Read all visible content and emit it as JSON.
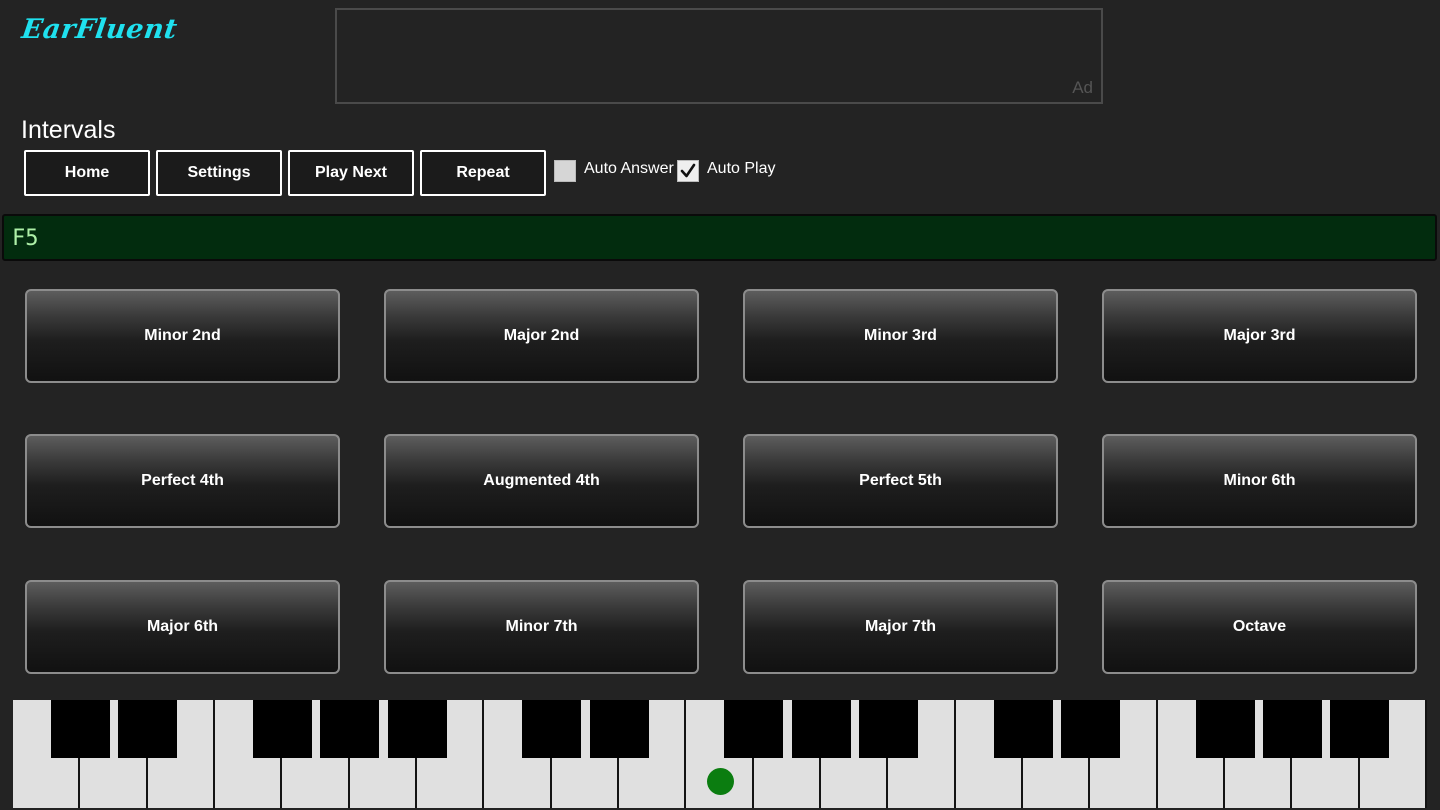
{
  "app": {
    "logo": "EarFluent"
  },
  "ad": {
    "label": "Ad"
  },
  "page": {
    "title": "Intervals"
  },
  "toolbar": {
    "home_label": "Home",
    "settings_label": "Settings",
    "play_next_label": "Play Next",
    "repeat_label": "Repeat"
  },
  "options": {
    "auto_answer": {
      "label": "Auto Answer",
      "checked": false
    },
    "auto_play": {
      "label": "Auto Play",
      "checked": true
    }
  },
  "display": {
    "note": "F5"
  },
  "answers": [
    "Minor 2nd",
    "Major 2nd",
    "Minor 3rd",
    "Major 3rd",
    "Perfect 4th",
    "Augmented 4th",
    "Perfect 5th",
    "Minor 6th",
    "Major 6th",
    "Minor 7th",
    "Major 7th",
    "Octave"
  ],
  "piano": {
    "white_key_count": 21,
    "marked_white_key": 10
  },
  "colors": {
    "logo": "#1fe1ef",
    "note_bar_bg": "#022c0e",
    "note_text": "#aef0a8",
    "key_marker": "#0b7d10"
  }
}
